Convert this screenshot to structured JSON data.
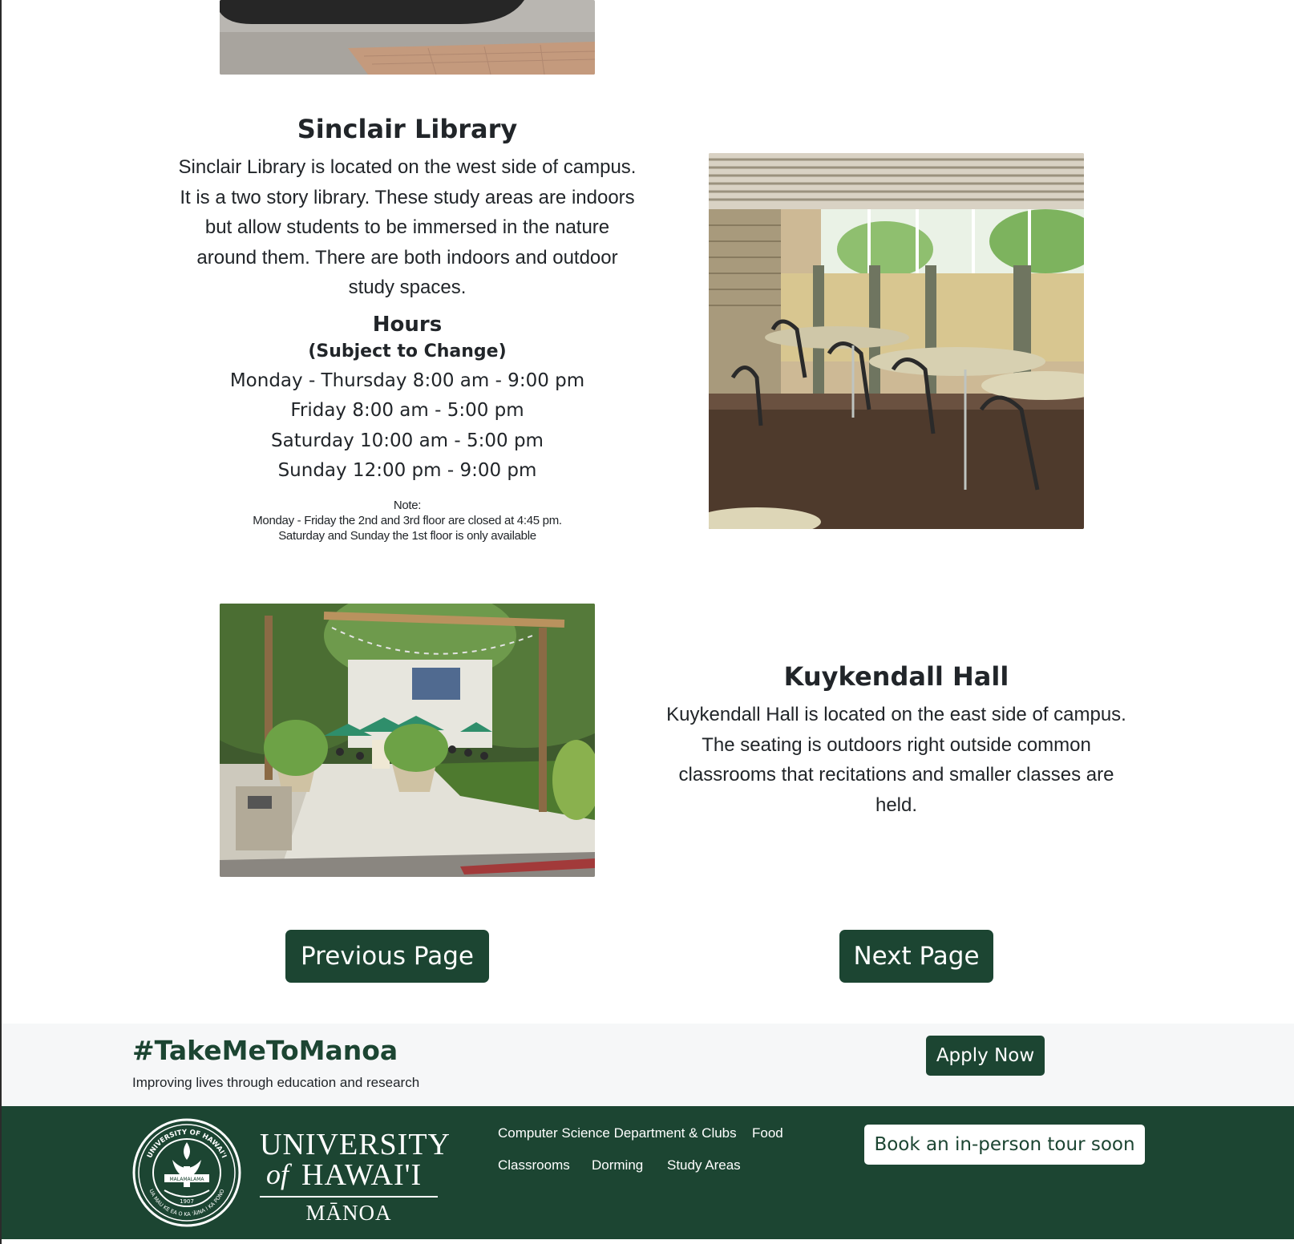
{
  "sections": [
    {
      "title": "Sinclair Library",
      "description": "Sinclair Library is located on the west side of campus. It is a two story library. These study areas are indoors but allow students to be immersed in the nature around them. There are both indoors and outdoor study spaces.",
      "hours": {
        "heading": "Hours",
        "subheading": "(Subject to Change)",
        "lines": [
          "Monday - Thursday 8:00 am - 9:00 pm",
          "Friday 8:00 am - 5:00 pm",
          "Saturday 10:00 am - 5:00 pm",
          "Sunday 12:00 pm - 9:00 pm"
        ],
        "note_label": "Note:",
        "notes": [
          "Monday - Friday the 2nd and 3rd floor are closed at 4:45 pm.",
          "Saturday and Sunday the 1st floor is only available"
        ]
      }
    },
    {
      "title": "Kuykendall Hall",
      "description": "Kuykendall Hall is located on the east side of campus. The seating is outdoors right outside common classrooms that recitations and smaller classes are held."
    }
  ],
  "pagination": {
    "previous_label": "Previous Page",
    "next_label": "Next Page"
  },
  "cta": {
    "hashtag": "#TakeMeToManoa",
    "tagline": "Improving lives through education and research",
    "apply_label": "Apply Now"
  },
  "footer": {
    "seal_text_top": "UNIVERSITY OF HAWAI'I",
    "seal_text_bottom": "UA MAU KE EA O KA 'ĀINA I KA PONO",
    "seal_banner": "MALAMALAMA",
    "seal_year": "1907",
    "wordmark_line1": "UNIVERSITY",
    "wordmark_of": "of",
    "wordmark_line2": "HAWAI'I",
    "wordmark_line3": "MĀNOA",
    "links": [
      "Computer Science Department & Clubs",
      "Food",
      "Classrooms",
      "Dorming",
      "Study Areas"
    ],
    "tour_label": "Book an in-person tour soon"
  },
  "colors": {
    "primary_green": "#1c4532",
    "band_background": "#f6f7f8",
    "white": "#ffffff"
  }
}
